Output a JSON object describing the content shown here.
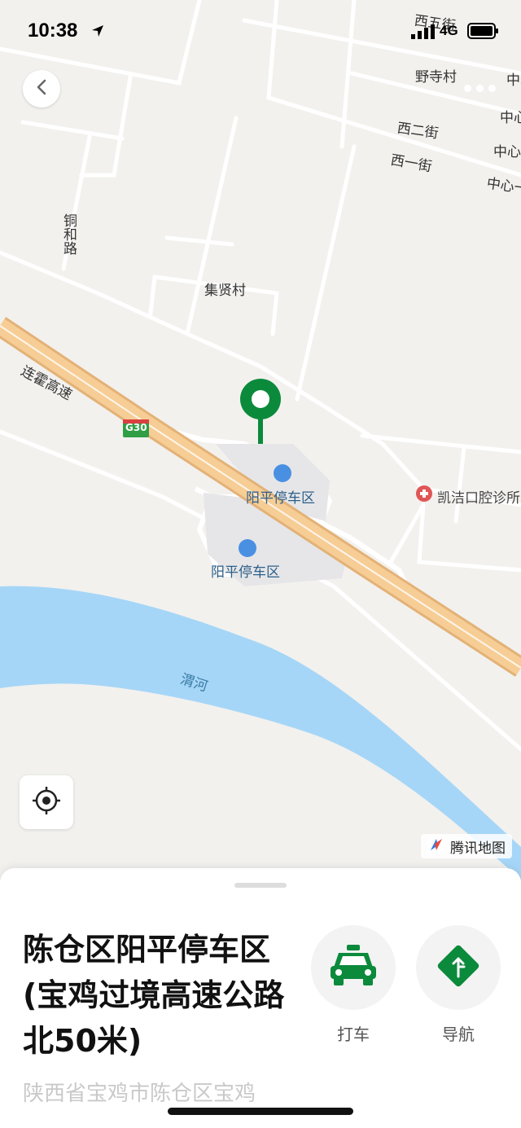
{
  "status_bar": {
    "time": "10:38",
    "network": "4G"
  },
  "map": {
    "labels": {
      "xiwu_street": "西五街",
      "yesi_village": "野寺村",
      "xier_street": "西二街",
      "xiyi_street": "西一街",
      "zhongxin_1": "中心",
      "zhongxin_2": "中心",
      "zhongxin_3": "中心",
      "zhongxin_4": "中心一",
      "tonghe_road": "铜和路",
      "jixian_village": "集贤村",
      "lianhuo_expressway": "连霍高速",
      "highway_shield": "G30",
      "parking_north": "阳平停车区",
      "parking_south": "阳平停车区",
      "kaijie_dental": "凯洁口腔诊所",
      "wei_river": "渭河"
    },
    "attribution": "腾讯地图",
    "colors": {
      "road_orange": "#f3c58b",
      "river_blue": "#a6d6f7",
      "pin_green": "#0b8a3c"
    }
  },
  "sheet": {
    "title": "陈仓区阳平停车区(宝鸡过境高速公路北50米)",
    "address": "陕西省宝鸡市陈仓区宝鸡",
    "actions": {
      "taxi_label": "打车",
      "navigate_label": "导航"
    }
  }
}
